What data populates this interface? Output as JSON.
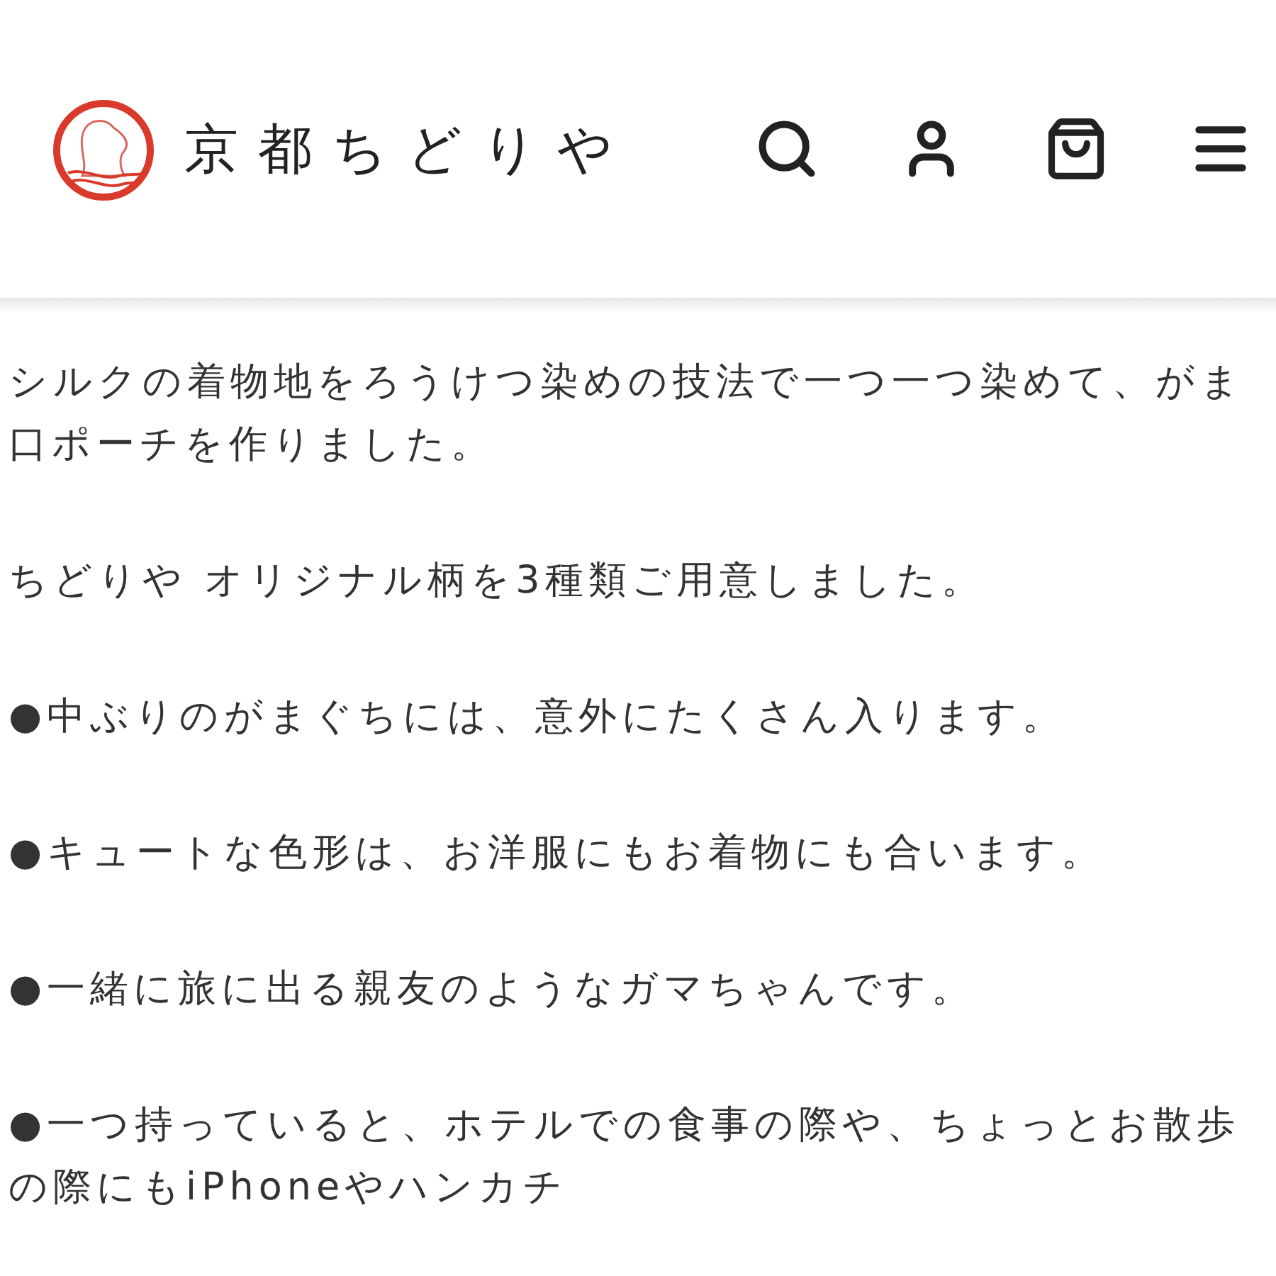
{
  "header": {
    "logo_text": "京都ちどりや"
  },
  "paragraphs": [
    "シルクの着物地をろうけつ染めの技法で一つ一つ染めて、がま口ポーチを作りました。",
    "ちどりや オリジナル柄を3種類ご用意しました。",
    "●中ぶりのがまぐちには、意外にたくさん入ります。",
    "●キュートな色形は、お洋服にもお着物にも合います。",
    "●一緒に旅に出る親友のようなガマちゃんです。",
    "●一つ持っていると、ホテルでの食事の際や、ちょっとお散歩の際にもiPhoneやハンカチ"
  ]
}
